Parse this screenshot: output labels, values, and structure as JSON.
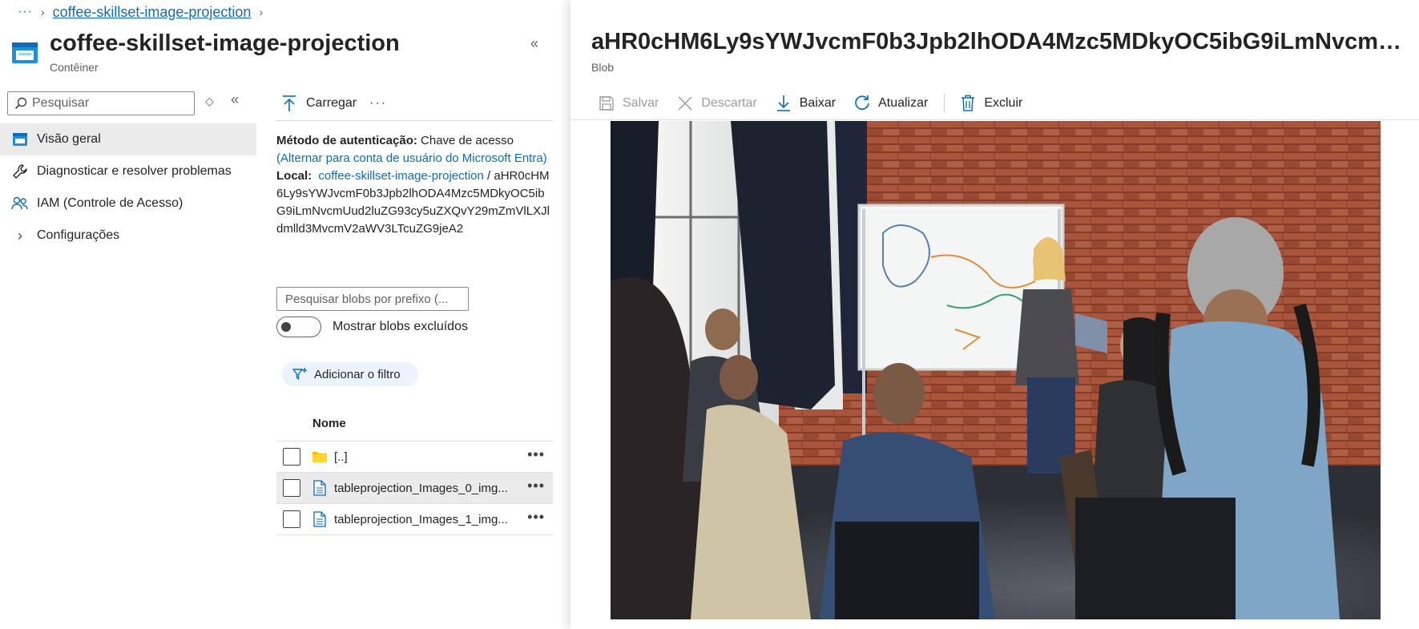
{
  "breadcrumb": {
    "ellipsis": "···",
    "current": "coffee-skillset-image-projection"
  },
  "container": {
    "title": "coffee-skillset-image-projection",
    "subtitle": "Contêiner"
  },
  "nav": {
    "search_placeholder": "Pesquisar",
    "items": [
      {
        "label": "Visão geral",
        "icon": "container-icon",
        "active": true
      },
      {
        "label": "Diagnosticar e resolver problemas",
        "icon": "wrench-icon"
      },
      {
        "label": "IAM (Controle de Acesso)",
        "icon": "people-icon"
      },
      {
        "label": "Configurações",
        "icon": "chevron-right-icon"
      }
    ]
  },
  "middle": {
    "upload_label": "Carregar",
    "more": "···",
    "auth_label": "Método de autenticação:",
    "auth_value": "Chave de acesso",
    "auth_switch": "(Alternar para conta de usuário do Microsoft Entra)",
    "location_label": "Local:",
    "location_link": "coffee-skillset-image-projection",
    "location_sep": "/",
    "location_path": "aHR0cHM6Ly9sYWJvcmF0b3Jpb2lhODA4Mzc5MDkyOC5ibG9iLmNvcmUud2luZG93cy5uZXQvY29mZmVlLXJldmlld3MvcmV2aWV3LTcuZG9jeA2",
    "prefix_search_placeholder": "Pesquisar blobs por prefixo (...",
    "show_deleted_label": "Mostrar blobs excluídos",
    "show_deleted_on": false,
    "add_filter_label": "Adicionar o filtro",
    "column_name": "Nome",
    "rows": [
      {
        "name": "[..]",
        "icon": "folder-icon",
        "selected": false
      },
      {
        "name": "tableprojection_Images_0_img...",
        "icon": "document-icon",
        "selected": true
      },
      {
        "name": "tableprojection_Images_1_img...",
        "icon": "document-icon",
        "selected": false
      }
    ],
    "row_more": "•••"
  },
  "blob": {
    "title": "aHR0cHM6Ly9sYWJvcmF0b3Jpb2lhODA4Mzc5MDkyOC5ibG9iLmNvcmUu...",
    "subtitle": "Blob",
    "toolbar": {
      "save": "Salvar",
      "discard": "Descartar",
      "download": "Baixar",
      "refresh": "Atualizar",
      "delete": "Excluir"
    }
  },
  "colors": {
    "accent": "#0f6cbd",
    "selected_bg": "#ebebeb",
    "filter_bg": "#ebf3fc"
  }
}
